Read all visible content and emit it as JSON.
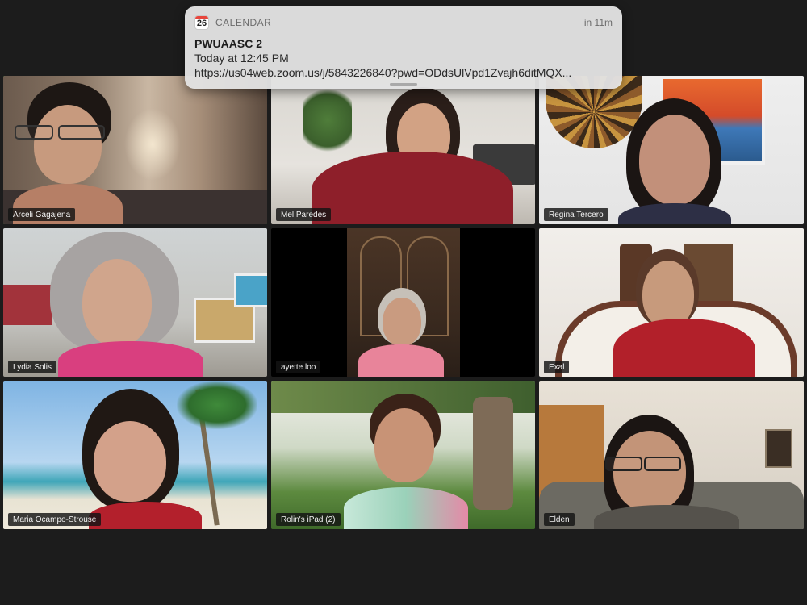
{
  "notification": {
    "app_name": "CALENDAR",
    "icon_day": "26",
    "time_until": "in 11m",
    "title": "PWUAASC 2",
    "when": "Today at 12:45 PM",
    "link": "https://us04web.zoom.us/j/5843226840?pwd=ODdsUlVpd1Zvajh6ditMQX..."
  },
  "participants": [
    {
      "name": "Arceli Gagajena",
      "active_speaker": true
    },
    {
      "name": "Mel Paredes",
      "active_speaker": false
    },
    {
      "name": "Regina Tercero",
      "active_speaker": false
    },
    {
      "name": "Lydia Solis",
      "active_speaker": false
    },
    {
      "name": "ayette loo",
      "active_speaker": false
    },
    {
      "name": "Exal",
      "active_speaker": false
    },
    {
      "name": "Maria Ocampo-Strouse",
      "active_speaker": false
    },
    {
      "name": "Rolin's iPad (2)",
      "active_speaker": false
    },
    {
      "name": "Elden",
      "active_speaker": false
    }
  ],
  "colors": {
    "background": "#1c1c1c",
    "active_speaker_border": "#3fe05a",
    "notification_bg": "#e2e2e2"
  }
}
